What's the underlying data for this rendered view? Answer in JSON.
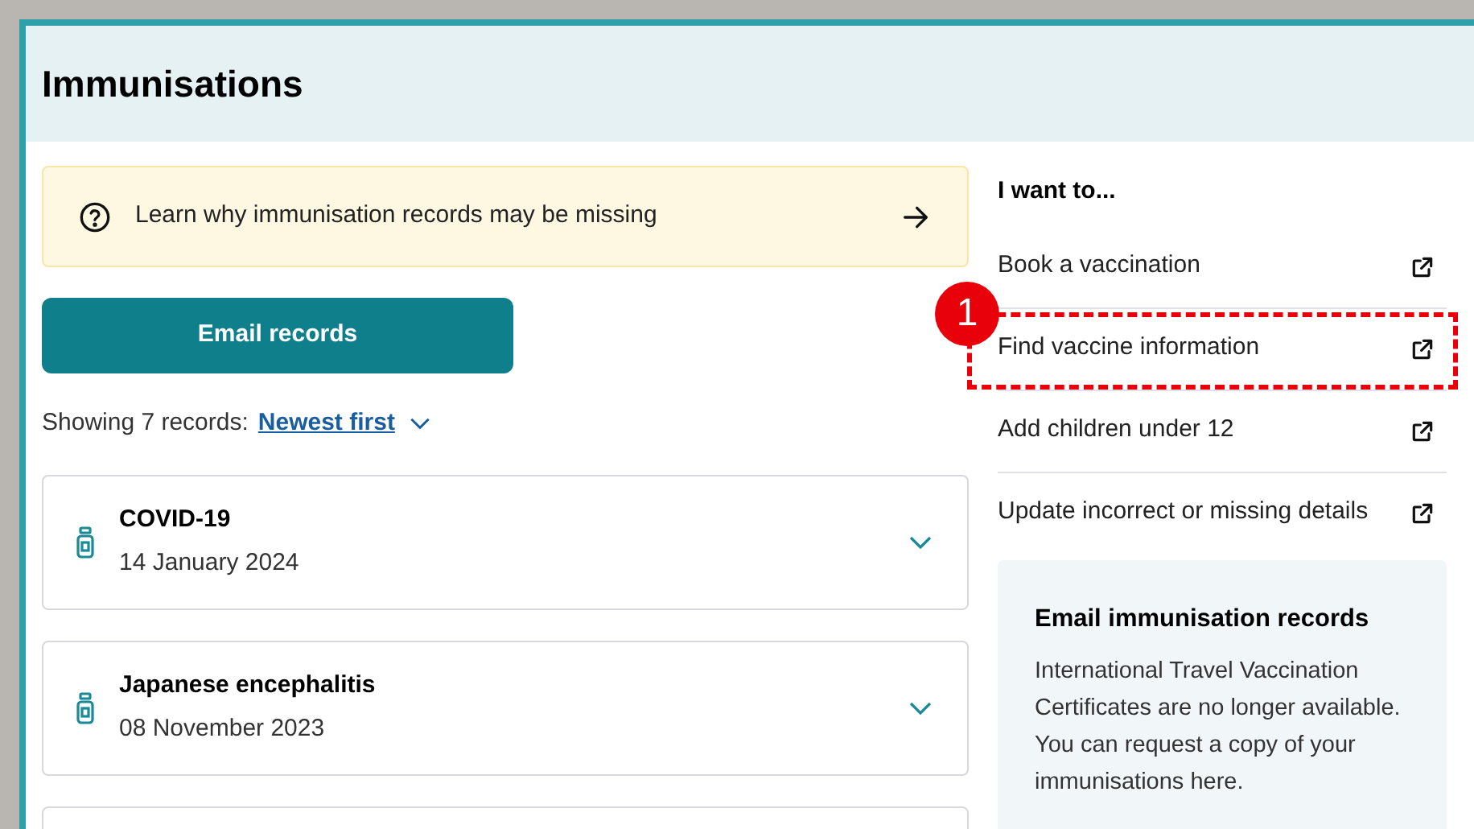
{
  "page_title": "Immunisations",
  "notice": {
    "text": "Learn why immunisation records may be missing"
  },
  "email_button": "Email records",
  "sort": {
    "prefix": "Showing 7 records:",
    "value": "Newest first"
  },
  "records": [
    {
      "name": "COVID-19",
      "date": "14 January 2024",
      "expanded": false
    },
    {
      "name": "Japanese encephalitis",
      "date": "08 November 2023",
      "expanded": false
    }
  ],
  "sidebar": {
    "heading": "I want to...",
    "links": [
      {
        "label": "Book a vaccination",
        "highlighted": false
      },
      {
        "label": "Find vaccine information",
        "highlighted": true
      },
      {
        "label": "Add children under 12",
        "highlighted": false
      },
      {
        "label": "Update incorrect or missing details",
        "highlighted": false
      }
    ]
  },
  "info_card": {
    "title": "Email immunisation records",
    "body": "International Travel Vaccination Certificates are no longer available. You can request a copy of your immunisations here."
  },
  "annotation": {
    "number": "1"
  }
}
